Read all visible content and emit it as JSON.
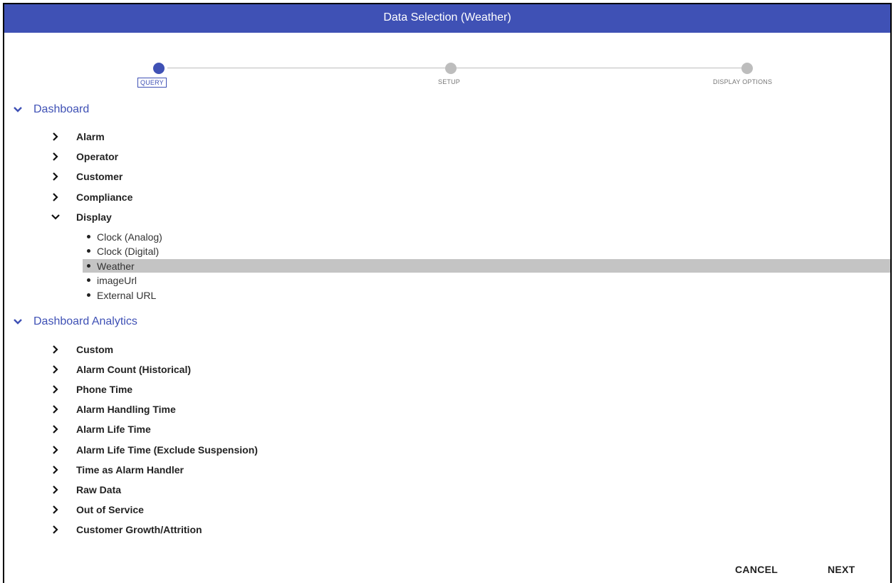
{
  "dialog": {
    "title": "Data Selection (Weather)"
  },
  "stepper": {
    "steps": [
      {
        "label": "QUERY",
        "state": "active"
      },
      {
        "label": "SETUP",
        "state": "inactive"
      },
      {
        "label": "DISPLAY OPTIONS",
        "state": "inactive"
      }
    ]
  },
  "tree": {
    "groups": [
      {
        "label": "Dashboard",
        "expanded": true,
        "nodes": [
          {
            "label": "Alarm",
            "expanded": false
          },
          {
            "label": "Operator",
            "expanded": false
          },
          {
            "label": "Customer",
            "expanded": false
          },
          {
            "label": "Compliance",
            "expanded": false
          },
          {
            "label": "Display",
            "expanded": true,
            "items": [
              {
                "label": "Clock (Analog)",
                "selected": false
              },
              {
                "label": "Clock (Digital)",
                "selected": false
              },
              {
                "label": "Weather",
                "selected": true
              },
              {
                "label": "imageUrl",
                "selected": false
              },
              {
                "label": "External URL",
                "selected": false
              }
            ]
          }
        ]
      },
      {
        "label": "Dashboard Analytics",
        "expanded": true,
        "nodes": [
          {
            "label": "Custom",
            "expanded": false
          },
          {
            "label": "Alarm Count (Historical)",
            "expanded": false
          },
          {
            "label": "Phone Time",
            "expanded": false
          },
          {
            "label": "Alarm Handling Time",
            "expanded": false
          },
          {
            "label": "Alarm Life Time",
            "expanded": false
          },
          {
            "label": "Alarm Life Time (Exclude Suspension)",
            "expanded": false
          },
          {
            "label": "Time as Alarm Handler",
            "expanded": false
          },
          {
            "label": "Raw Data",
            "expanded": false
          },
          {
            "label": "Out of Service",
            "expanded": false
          },
          {
            "label": "Customer Growth/Attrition",
            "expanded": false
          }
        ]
      }
    ]
  },
  "actions": {
    "cancel_label": "CANCEL",
    "next_label": "NEXT"
  },
  "colors": {
    "primary": "#3f51b5",
    "selected_row": "#c4c4c4",
    "inactive_step": "#bdbdbd"
  },
  "icons": {
    "expanded": "chevron-down-icon",
    "collapsed": "chevron-right-icon",
    "leaf": "bullet-icon"
  }
}
